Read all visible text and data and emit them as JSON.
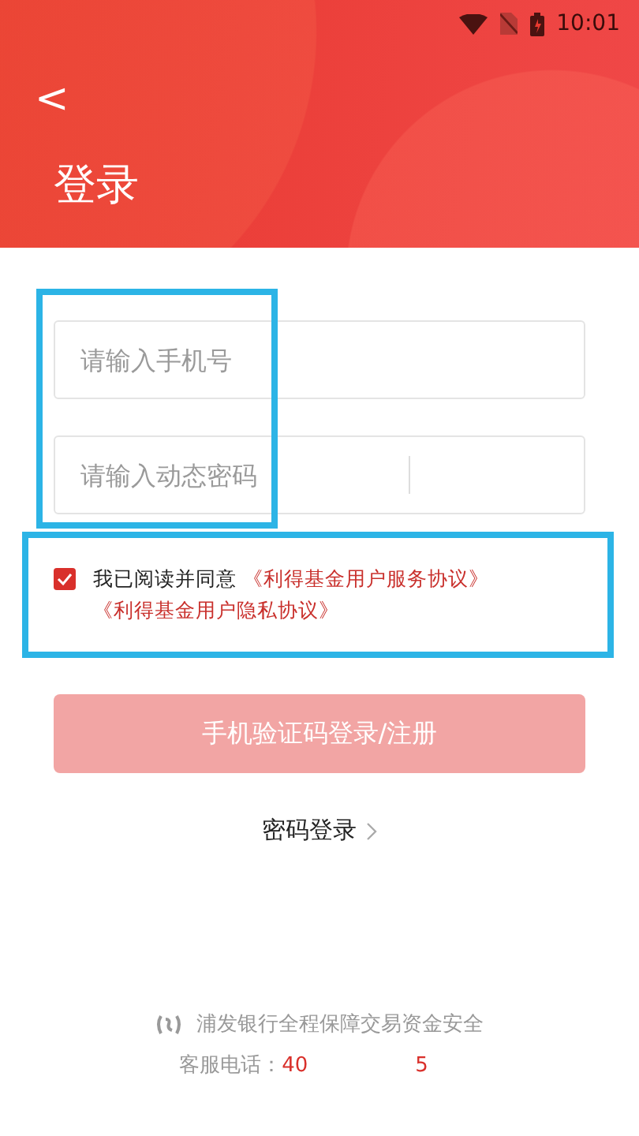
{
  "status_bar": {
    "time": "10:01"
  },
  "header": {
    "back": "<",
    "title": "登录"
  },
  "fields": [
    {
      "placeholder": "请输入手机号",
      "kind": "phone",
      "highlighted": true
    },
    {
      "placeholder": "请输入动态密码",
      "kind": "code",
      "highlighted": true
    }
  ],
  "agreement": {
    "checked": true,
    "highlighted": true,
    "text": "我已阅读并同意",
    "links": [
      "《利得基金用户服务协议》",
      "《利得基金用户隐私协议》"
    ]
  },
  "submit": {
    "label": "手机验证码登录/注册",
    "disabled": true
  },
  "alt_login": {
    "label": "密码登录"
  },
  "footer": {
    "guarantee": "浦发银行全程保障交易资金安全",
    "phone_label": "客服电话：",
    "phone_parts": [
      "40",
      "5"
    ]
  }
}
